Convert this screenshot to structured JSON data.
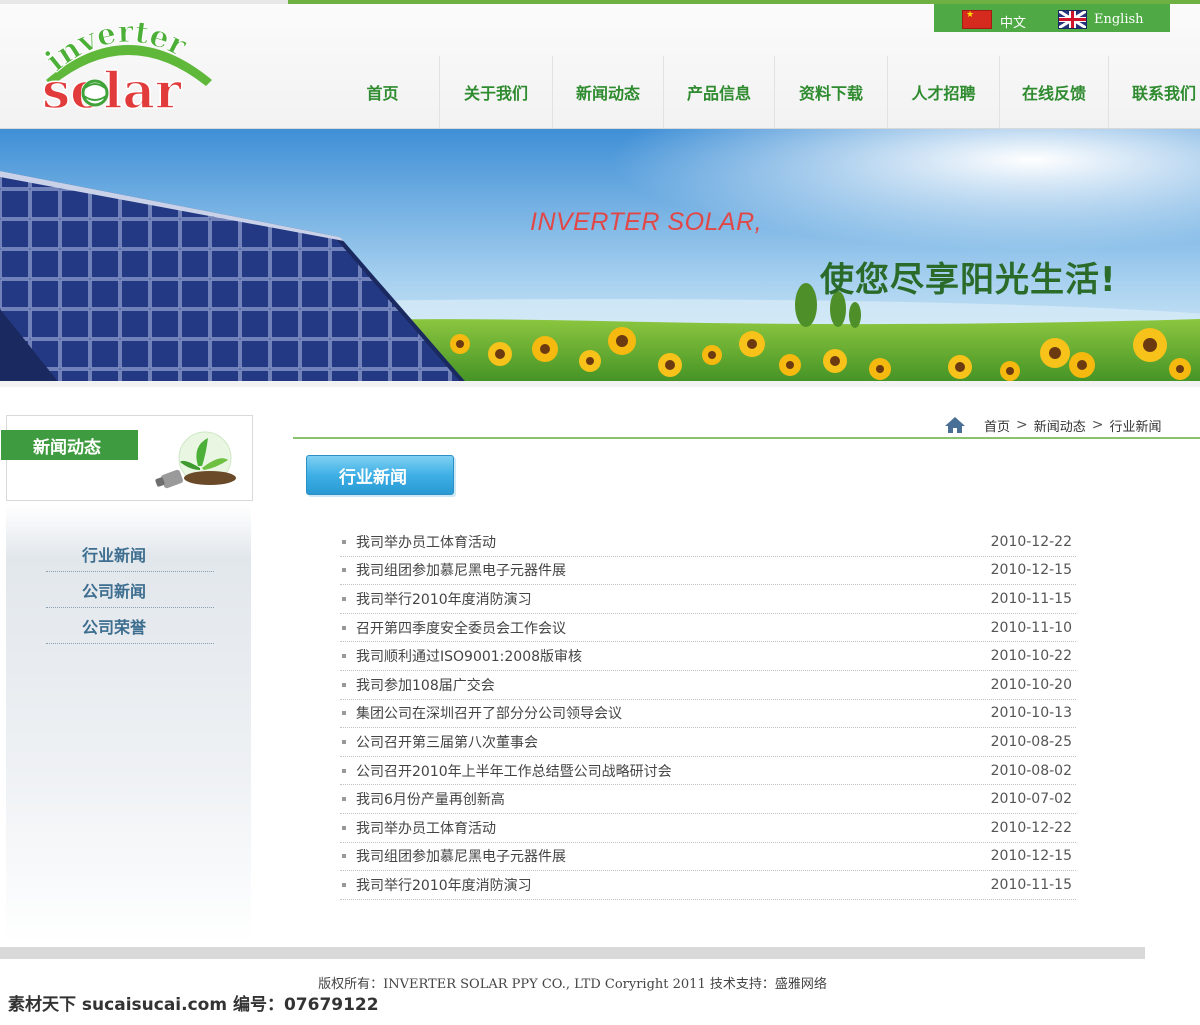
{
  "header": {
    "logo_text_top": "inverter",
    "logo_text_main": "solar",
    "lang": {
      "cn_label": "中文",
      "en_label": "English"
    },
    "nav": [
      "首页",
      "关于我们",
      "新闻动态",
      "产品信息",
      "资料下载",
      "人才招聘",
      "在线反馈",
      "联系我们"
    ]
  },
  "banner": {
    "en_slogan": "INVERTER SOLAR,",
    "cn_slogan": "使您尽享阳光生活!"
  },
  "sidebar": {
    "heading": "新闻动态",
    "items": [
      "行业新闻",
      "公司新闻",
      "公司荣誉"
    ]
  },
  "breadcrumb": [
    "首页",
    "新闻动态",
    "行业新闻"
  ],
  "section_title": "行业新闻",
  "news": [
    {
      "title": "我司举办员工体育活动",
      "date": "2010-12-22"
    },
    {
      "title": "我司组团参加慕尼黑电子元器件展",
      "date": "2010-12-15"
    },
    {
      "title": "我司举行2010年度消防演习",
      "date": "2010-11-15"
    },
    {
      "title": "召开第四季度安全委员会工作会议",
      "date": "2010-11-10"
    },
    {
      "title": "我司顺利通过ISO9001:2008版审核",
      "date": "2010-10-22"
    },
    {
      "title": "我司参加108届广交会",
      "date": "2010-10-20"
    },
    {
      "title": "集团公司在深圳召开了部分分公司领导会议",
      "date": "2010-10-13"
    },
    {
      "title": "公司召开第三届第八次董事会",
      "date": "2010-08-25"
    },
    {
      "title": "公司召开2010年上半年工作总结暨公司战略研讨会",
      "date": "2010-08-02"
    },
    {
      "title": "我司6月份产量再创新高",
      "date": "2010-07-02"
    },
    {
      "title": "我司举办员工体育活动",
      "date": "2010-12-22"
    },
    {
      "title": "我司组团参加慕尼黑电子元器件展",
      "date": "2010-12-15"
    },
    {
      "title": "我司举行2010年度消防演习",
      "date": "2010-11-15"
    }
  ],
  "footer": {
    "copyright": "版权所有：INVERTER SOLAR PPY CO., LTD  Coryright 2011  技术支持：盛雅网络"
  },
  "watermark": "素材天下 sucaisucai.com  编号：07679122",
  "colors": {
    "brand_green": "#4faa45",
    "nav_text": "#2f8b2f",
    "tab_blue": "#3fb0e6"
  }
}
